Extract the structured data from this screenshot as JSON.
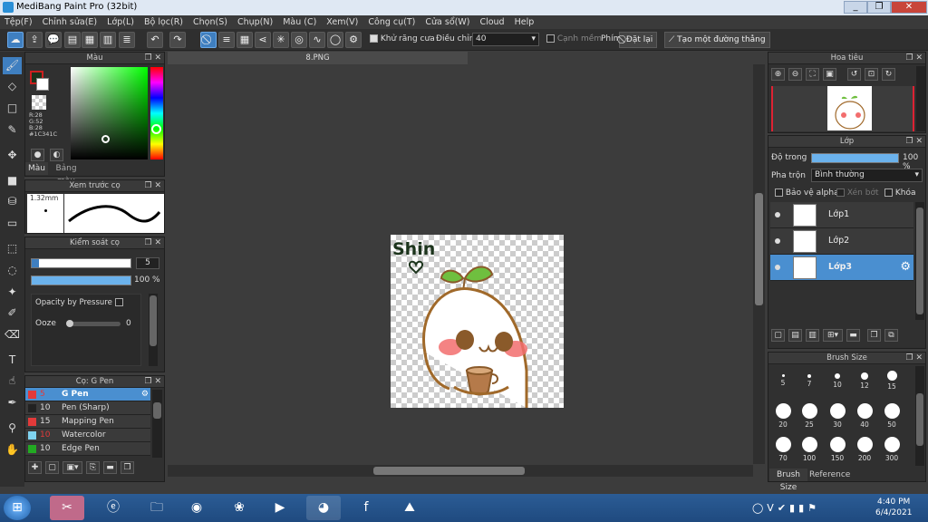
{
  "window": {
    "title": "MediBang Paint Pro (32bit)",
    "controls": [
      "_",
      "❐",
      "✕"
    ]
  },
  "menu": [
    "Tệp(F)",
    "Chỉnh sửa(E)",
    "Lớp(L)",
    "Bộ lọc(R)",
    "Chọn(S)",
    "Chụp(N)",
    "Màu (C)",
    "Xem(V)",
    "Công cụ(T)",
    "Cửa sổ(W)",
    "Cloud",
    "Help"
  ],
  "toolbar": {
    "antialias_label": "Khử răng cưa",
    "adjust_label": "Điều chỉnh",
    "adjust_value": "40",
    "edge_label": "Cạnh mềm",
    "key_label": "Phím",
    "reset_label": "Đặt lại",
    "straight_label": "Tạo một đường thẳng"
  },
  "color_panel": {
    "title": "Màu",
    "r": "R:28",
    "g": "G:52",
    "b": "B:28",
    "hex": "#1C341C",
    "tab_color": "Màu",
    "tab_palette": "Bảng màu",
    "primary_color": "#1C341C",
    "accent_red": "#cc2020"
  },
  "brush_preview": {
    "title": "Xem trước cọ",
    "size": "1.32mm"
  },
  "brush_control": {
    "title": "Kiểm soát cọ",
    "size": "5",
    "opacity": "100 %",
    "opacity_pressure": "Opacity by Pressure",
    "ooze_label": "Ooze",
    "ooze_value": "0"
  },
  "brush_list": {
    "title": "Cọ: G Pen",
    "items": [
      {
        "size": "5",
        "name": "G Pen",
        "color": "#e23a3a",
        "selected": true
      },
      {
        "size": "10",
        "name": "Pen (Sharp)",
        "color": "#222222",
        "selected": false
      },
      {
        "size": "15",
        "name": "Mapping Pen",
        "color": "#e23a3a",
        "selected": false
      },
      {
        "size": "10",
        "name": "Watercolor",
        "color": "#7fd3f0",
        "selected": false
      },
      {
        "size": "10",
        "name": "Edge Pen",
        "color": "#22aa22",
        "selected": false
      }
    ]
  },
  "document": {
    "tab": "8.PNG",
    "art_text": "Shin"
  },
  "navigator": {
    "title": "Hoa tiêu"
  },
  "layer_panel": {
    "title": "Lớp",
    "opacity_label": "Độ trong",
    "opacity_value": "100 %",
    "blend_label": "Pha trộn",
    "blend_value": "Bình thường",
    "protect_alpha": "Bảo vệ alpha",
    "clip": "Xén bớt",
    "lock": "Khóa",
    "layers": [
      {
        "name": "Lớp1",
        "selected": false
      },
      {
        "name": "Lớp2",
        "selected": false
      },
      {
        "name": "Lớp3",
        "selected": true
      }
    ]
  },
  "brush_size": {
    "title": "Brush Size",
    "sizes": [
      "5",
      "7",
      "10",
      "12",
      "15",
      "20",
      "25",
      "30",
      "40",
      "50",
      "70",
      "100",
      "150",
      "200",
      "300"
    ],
    "tab_size": "Brush Size",
    "tab_reference": "Reference"
  },
  "taskbar": {
    "time": "4:40 PM",
    "date": "6/4/2021"
  }
}
